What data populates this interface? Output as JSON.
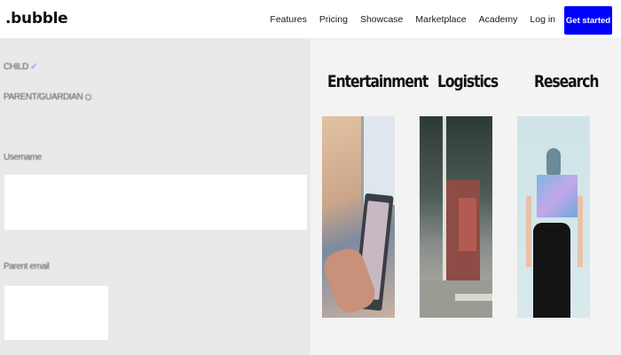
{
  "nav": {
    "logo": ".bubble",
    "links": [
      "Features",
      "Pricing",
      "Showcase",
      "Marketplace",
      "Academy",
      "Log in"
    ],
    "cta": "Get started",
    "cta_color": "#0000ff"
  },
  "form": {
    "child_label": "CHILD",
    "parent_label": "PARENT/GUARDIAN",
    "username_label": "Username",
    "username_value": "",
    "email_label": "Parent email",
    "email_value": ""
  },
  "showcase": {
    "categories": [
      {
        "title": "Entertainment",
        "image": "person-using-tablet-image"
      },
      {
        "title": "Logistics",
        "image": "truck-on-road-image"
      },
      {
        "title": "Research",
        "image": "person-holding-screen-image"
      }
    ]
  }
}
